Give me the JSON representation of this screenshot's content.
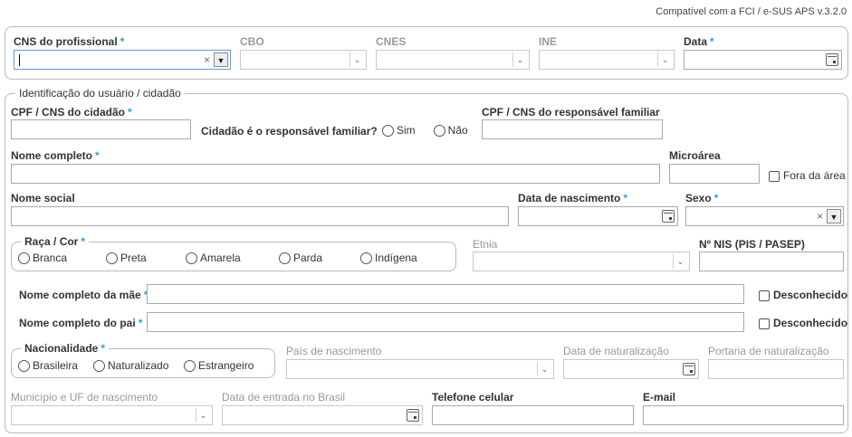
{
  "compat_text": "Compatível com a FCI / e-SUS APS v.3.2.0",
  "top": {
    "cns_label": "CNS do profissional",
    "cbo_label": "CBO",
    "cnes_label": "CNES",
    "ine_label": "INE",
    "data_label": "Data"
  },
  "usuario": {
    "legend": "Identificação do usuário / cidadão",
    "cpf_label": "CPF / CNS do cidadão",
    "responsavel_q": "Cidadão é o responsável familiar?",
    "sim": "Sim",
    "nao": "Não",
    "cpf_resp_label": "CPF / CNS do responsável familiar",
    "nome_label": "Nome completo",
    "microarea_label": "Microárea",
    "fora_area": "Fora da área",
    "nome_social_label": "Nome social",
    "nascimento_label": "Data de nascimento",
    "sexo_label": "Sexo",
    "raca_legend": "Raça / Cor",
    "raca_options": [
      "Branca",
      "Preta",
      "Amarela",
      "Parda",
      "Indígena"
    ],
    "etnia_label": "Etnia",
    "nis_label": "Nº NIS (PIS / PASEP)",
    "mae_label": "Nome completo da mãe",
    "pai_label": "Nome completo do pai",
    "desconhecido": "Desconhecido",
    "nac_legend": "Nacionalidade",
    "nac_options": [
      "Brasileira",
      "Naturalizado",
      "Estrangeiro"
    ],
    "pais_label": "País de nascimento",
    "data_nat_label": "Data de naturalização",
    "portaria_label": "Portaria de naturalização",
    "municipio_label": "Município e UF de nascimento",
    "data_entrada_label": "Data de entrada no Brasil",
    "telefone_label": "Telefone celular",
    "email_label": "E-mail"
  },
  "required_mark": "*",
  "icons": {
    "chevron": "chevron-down-icon",
    "clear": "clear-icon",
    "calendar": "calendar-icon",
    "asterisk": "asterisk-icon"
  },
  "colors": {
    "required": "#2f9fd8",
    "focus_border": "#5b9dd9",
    "panel_border": "#b9b9b9"
  }
}
